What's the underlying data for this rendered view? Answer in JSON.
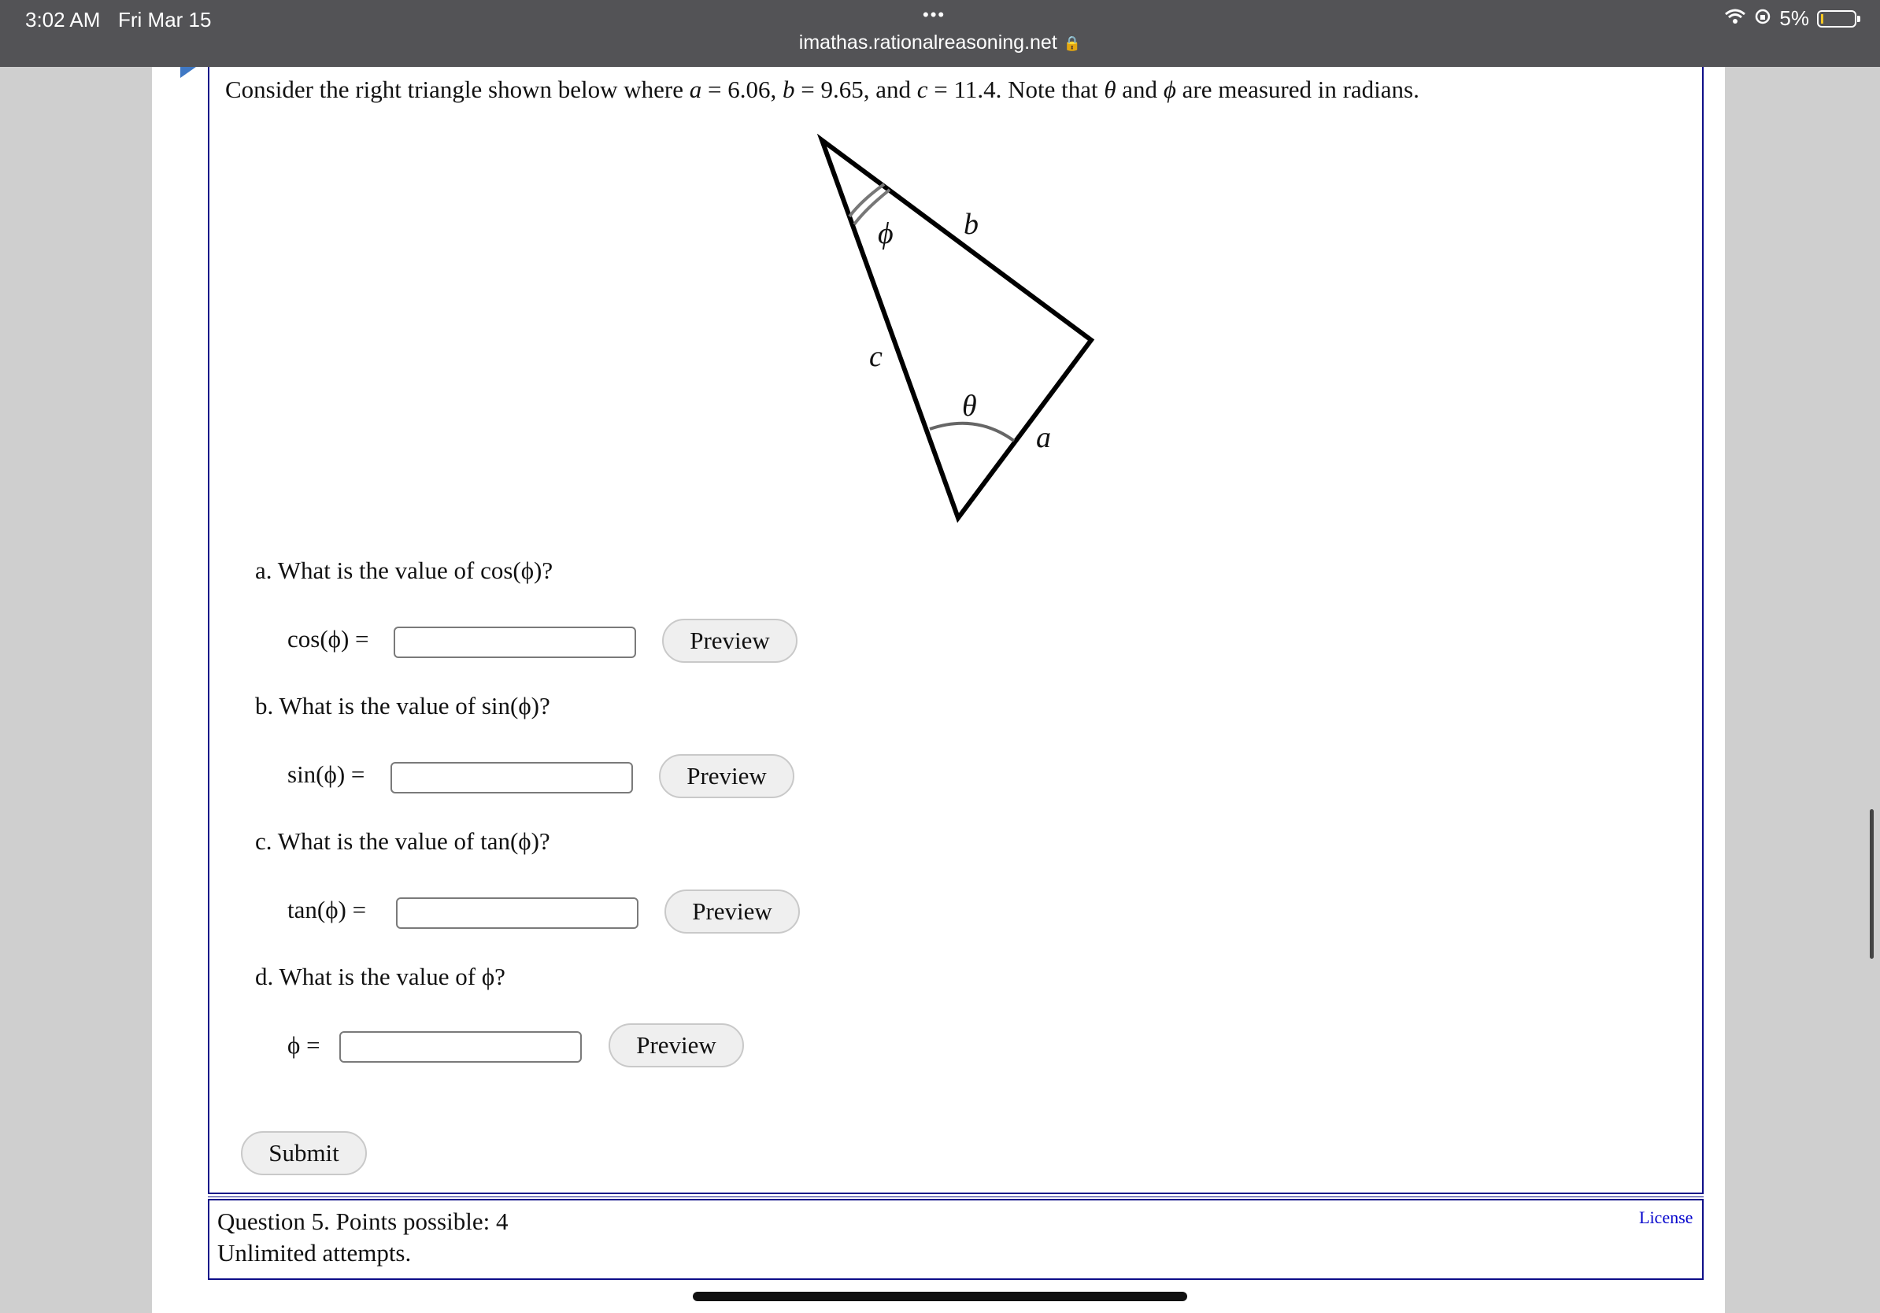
{
  "status_bar": {
    "time": "3:02 AM",
    "date": "Fri Mar 15",
    "battery": "5%",
    "battery_level": 0.05
  },
  "browser": {
    "url": "imathas.rationalreasoning.net",
    "dots": "•••"
  },
  "question": {
    "intro_1": "Consider the right triangle shown below where ",
    "a_sym": "a",
    "eq1": " = 6.06, ",
    "b_sym": "b",
    "eq2": " = 9.65, and ",
    "c_sym": "c",
    "eq3": " = 11.4. Note that ",
    "theta_sym": "θ",
    "and_word": " and ",
    "phi_sym": "ϕ",
    "intro_end": " are measured in radians."
  },
  "diagram": {
    "labels": {
      "phi": "ϕ",
      "b": "b",
      "c": "c",
      "theta": "θ",
      "a": "a"
    }
  },
  "parts": [
    {
      "label": "a.  What is the value of cos(ϕ)?",
      "lhs": "cos(ϕ)  =",
      "button": "Preview"
    },
    {
      "label": "b.  What is the value of sin(ϕ)?",
      "lhs": "sin(ϕ)  =",
      "button": "Preview"
    },
    {
      "label": "c.  What is the value of tan(ϕ)?",
      "lhs": "tan(ϕ)  =",
      "button": "Preview"
    },
    {
      "label": "d.  What is the value of ϕ?",
      "lhs": "ϕ =",
      "button": "Preview"
    }
  ],
  "submit_label": "Submit",
  "footer": {
    "points": "Question 5. Points possible: 4",
    "attempts": "Unlimited attempts.",
    "license": "License"
  }
}
